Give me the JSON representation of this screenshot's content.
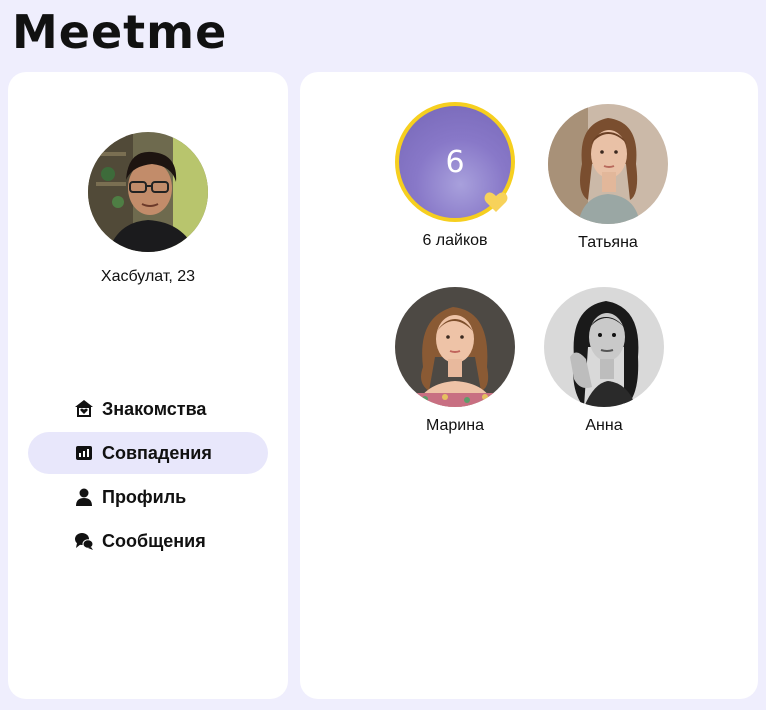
{
  "app": {
    "logo": "Meetme"
  },
  "user": {
    "name_age": "Хасбулат, 23"
  },
  "nav": [
    {
      "id": "dating",
      "label": "Знакомства",
      "icon": "home-heart-icon",
      "active": false
    },
    {
      "id": "matches",
      "label": "Совпадения",
      "icon": "chart-icon",
      "active": true
    },
    {
      "id": "profile",
      "label": "Профиль",
      "icon": "user-icon",
      "active": false
    },
    {
      "id": "messages",
      "label": "Сообщения",
      "icon": "chat-icon",
      "active": false
    }
  ],
  "matches": {
    "likes": {
      "count": "6",
      "label": "6 лайков"
    },
    "people": [
      {
        "name": "Татьяна"
      },
      {
        "name": "Марина"
      },
      {
        "name": "Анна"
      }
    ]
  },
  "colors": {
    "accent": "#e8e7fb",
    "likes_ring": "#f6cf1f",
    "background": "#efeefd"
  }
}
